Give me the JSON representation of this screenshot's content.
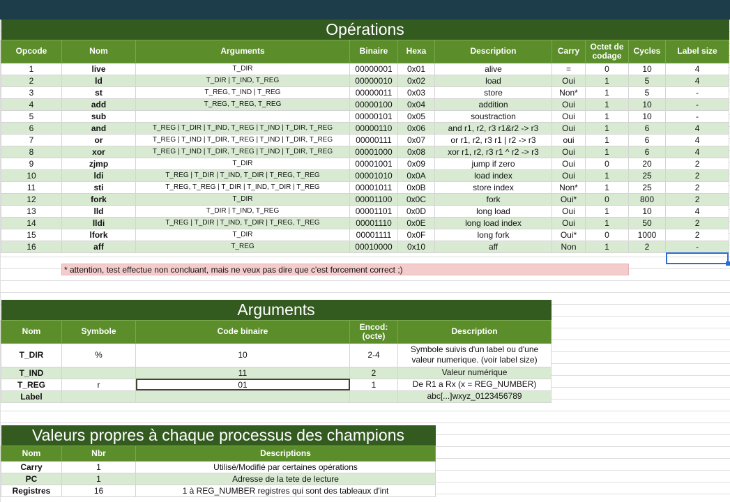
{
  "operations": {
    "title": "Opérations",
    "headers": [
      "Opcode",
      "Nom",
      "Arguments",
      "Binaire",
      "Hexa",
      "Description",
      "Carry",
      "Octet de codage",
      "Cycles",
      "Label size"
    ],
    "rows": [
      [
        "1",
        "live",
        "T_DIR",
        "00000001",
        "0x01",
        "alive",
        "=",
        "0",
        "10",
        "4"
      ],
      [
        "2",
        "ld",
        "T_DIR | T_IND, T_REG",
        "00000010",
        "0x02",
        "load",
        "Oui",
        "1",
        "5",
        "4"
      ],
      [
        "3",
        "st",
        "T_REG, T_IND | T_REG",
        "00000011",
        "0x03",
        "store",
        "Non*",
        "1",
        "5",
        "-"
      ],
      [
        "4",
        "add",
        "T_REG, T_REG, T_REG",
        "00000100",
        "0x04",
        "addition",
        "Oui",
        "1",
        "10",
        "-"
      ],
      [
        "5",
        "sub",
        "",
        "00000101",
        "0x05",
        "soustraction",
        "Oui",
        "1",
        "10",
        "-"
      ],
      [
        "6",
        "and",
        "T_REG | T_DIR | T_IND, T_REG | T_IND | T_DIR, T_REG",
        "00000110",
        "0x06",
        "and  r1, r2, r3   r1&r2 -> r3",
        "Oui",
        "1",
        "6",
        "4"
      ],
      [
        "7",
        "or",
        "T_REG | T_IND | T_DIR, T_REG | T_IND | T_DIR, T_REG",
        "00000111",
        "0x07",
        "or   r1, r2, r3   r1 | r2 -> r3",
        "oui",
        "1",
        "6",
        "4"
      ],
      [
        "8",
        "xor",
        "T_REG | T_IND | T_DIR, T_REG | T_IND | T_DIR, T_REG",
        "00001000",
        "0x08",
        "xor  r1, r2, r3   r1 ^ r2 -> r3",
        "Oui",
        "1",
        "6",
        "4"
      ],
      [
        "9",
        "zjmp",
        "T_DIR",
        "00001001",
        "0x09",
        "jump if zero",
        "Oui",
        "0",
        "20",
        "2"
      ],
      [
        "10",
        "ldi",
        "T_REG | T_DIR | T_IND, T_DIR | T_REG, T_REG",
        "00001010",
        "0x0A",
        "load index",
        "Oui",
        "1",
        "25",
        "2"
      ],
      [
        "11",
        "sti",
        "T_REG, T_REG | T_DIR | T_IND, T_DIR | T_REG",
        "00001011",
        "0x0B",
        "store index",
        "Non*",
        "1",
        "25",
        "2"
      ],
      [
        "12",
        "fork",
        "T_DIR",
        "00001100",
        "0x0C",
        "fork",
        "Oui*",
        "0",
        "800",
        "2"
      ],
      [
        "13",
        "lld",
        "T_DIR | T_IND, T_REG",
        "00001101",
        "0x0D",
        "long load",
        "Oui",
        "1",
        "10",
        "4"
      ],
      [
        "14",
        "lldi",
        "T_REG | T_DIR | T_IND, T_DIR | T_REG, T_REG",
        "00001110",
        "0x0E",
        "long load index",
        "Oui",
        "1",
        "50",
        "2"
      ],
      [
        "15",
        "lfork",
        "T_DIR",
        "00001111",
        "0x0F",
        "long fork",
        "Oui*",
        "0",
        "1000",
        "2"
      ],
      [
        "16",
        "aff",
        "T_REG",
        "00010000",
        "0x10",
        "aff",
        "Non",
        "1",
        "2",
        "-"
      ]
    ],
    "note": "* attention, test effectue non concluant, mais ne veux pas dire que c'est forcement correct ;)"
  },
  "arguments": {
    "title": "Arguments",
    "headers": [
      "Nom",
      "Symbole",
      "Code binaire",
      "Encod: (octe)",
      "Description"
    ],
    "rows": [
      [
        "T_DIR",
        "%",
        "10",
        "2-4",
        "Symbole suivis d'un label ou d'une valeur numerique. (voir label size)"
      ],
      [
        "T_IND",
        "",
        "11",
        "2",
        "Valeur numérique"
      ],
      [
        "T_REG",
        "r",
        "01",
        "1",
        "De R1 a Rx (x = REG_NUMBER)"
      ],
      [
        "Label",
        "",
        "",
        "",
        "abc[...]wxyz_0123456789"
      ]
    ]
  },
  "values": {
    "title": "Valeurs propres à chaque processus des champions",
    "headers": [
      "Nom",
      "Nbr",
      "Descriptions"
    ],
    "rows": [
      [
        "Carry",
        "1",
        "Utilisé/Modifié par certaines opérations"
      ],
      [
        "PC",
        "1",
        "Adresse de la tete de lecture"
      ],
      [
        "Registres",
        "16",
        "1 à REG_NUMBER registres qui sont des tableaux d'int"
      ]
    ]
  },
  "colors": {
    "title_bg": "#335a1f",
    "header_bg": "#5b8e2b",
    "row_alt": "#d9ead3",
    "note_bg": "#f4cccc",
    "topbar": "#1e3d4a"
  }
}
